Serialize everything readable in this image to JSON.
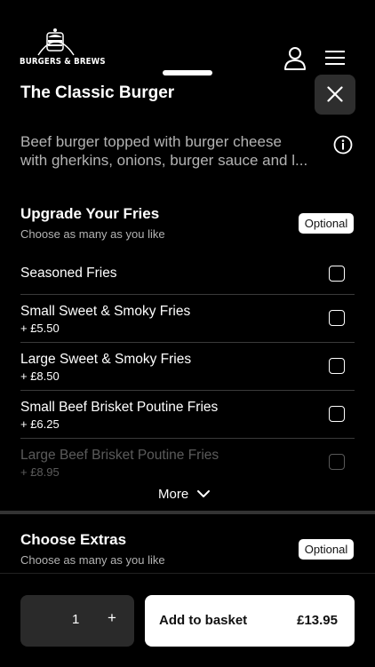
{
  "header": {
    "logo_text": "BURGERS & BREWS"
  },
  "item": {
    "title": "The Classic Burger",
    "description_line1": "Beef burger topped with burger cheese",
    "description_line2": "with gherkins, onions, burger sauce and l..."
  },
  "fries_section": {
    "title": "Upgrade Your Fries",
    "subtitle": "Choose as many as you like",
    "badge": "Optional",
    "options": [
      {
        "name": "Seasoned Fries",
        "price": "",
        "checked": false
      },
      {
        "name": "Small Sweet & Smoky Fries",
        "price": "+ £5.50",
        "checked": false
      },
      {
        "name": "Large Sweet & Smoky Fries",
        "price": "+ £8.50",
        "checked": false
      },
      {
        "name": "Small Beef Brisket Poutine Fries",
        "price": "+ £6.25",
        "checked": false
      },
      {
        "name": "Large Beef Brisket Poutine Fries",
        "price": "+ £8.95",
        "checked": false
      }
    ],
    "more_label": "More"
  },
  "extras_section": {
    "title": "Choose Extras",
    "subtitle": "Choose as many as you like",
    "badge": "Optional"
  },
  "footer": {
    "quantity": "1",
    "plus_label": "+",
    "add_label": "Add to basket",
    "total": "£13.95"
  },
  "colors": {
    "background": "#000000",
    "muted_text": "#b3b3b3",
    "close_button_bg": "#2e2e2e",
    "quantity_bg": "#2a2a2a",
    "primary_button_bg": "#ffffff"
  },
  "icons": [
    "burger-logo-icon",
    "user-icon",
    "menu-icon",
    "close-icon",
    "info-icon",
    "chevron-down-icon"
  ]
}
